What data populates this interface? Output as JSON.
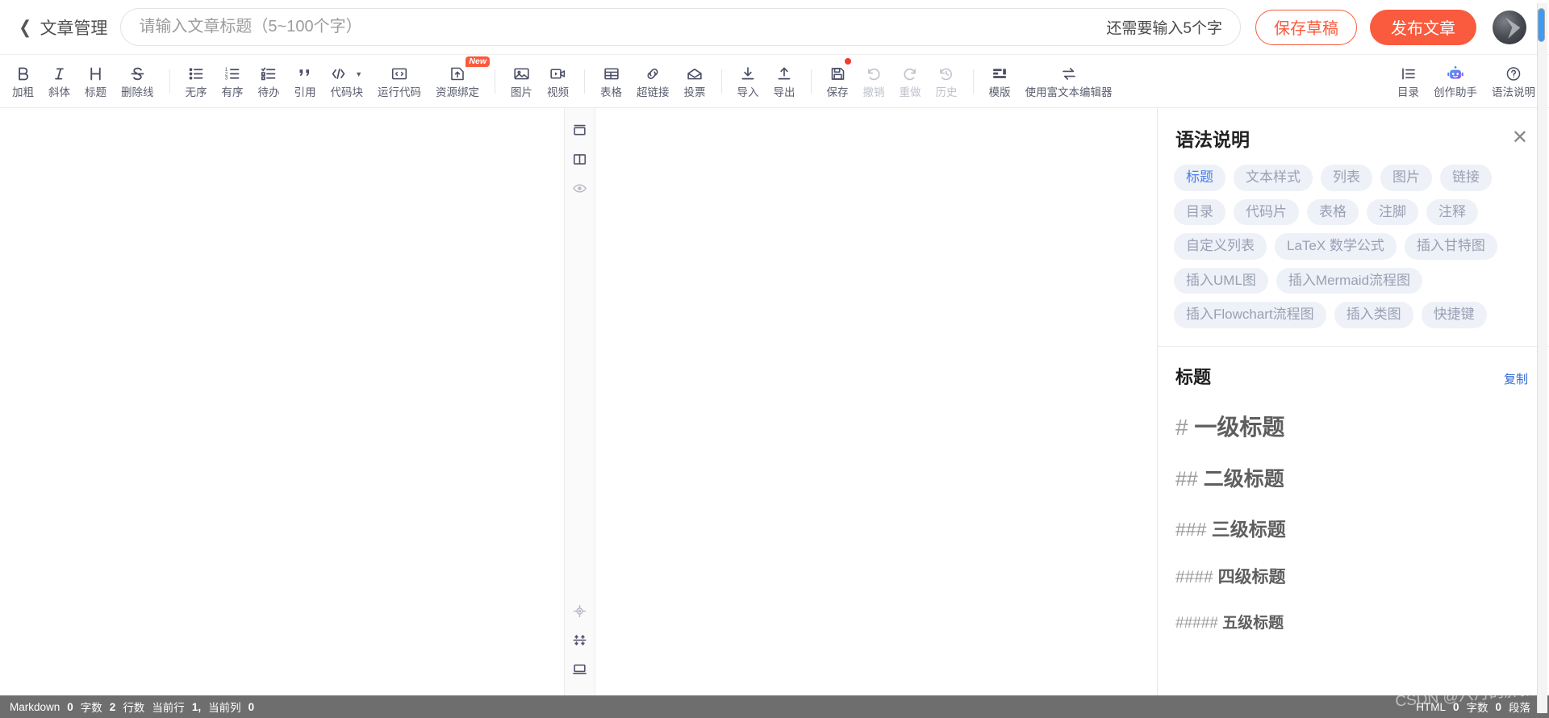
{
  "topbar": {
    "back_label": "文章管理",
    "back_icon": "chevron-left-icon",
    "title_placeholder": "请输入文章标题（5~100个字）",
    "title_value": "",
    "counter_text": "还需要输入5个字",
    "save_draft_label": "保存草稿",
    "publish_label": "发布文章",
    "accent_color": "#fa5a3d",
    "avatar_name": "user-avatar"
  },
  "toolbar": {
    "groups": [
      {
        "items": [
          {
            "icon": "bold-icon",
            "label": "加粗",
            "dim": false
          },
          {
            "icon": "italic-icon",
            "label": "斜体",
            "dim": false
          },
          {
            "icon": "heading-icon",
            "label": "标题",
            "dim": false
          },
          {
            "icon": "strikethrough-icon",
            "label": "删除线",
            "dim": false
          }
        ]
      },
      {
        "items": [
          {
            "icon": "unordered-list-icon",
            "label": "无序",
            "dim": false
          },
          {
            "icon": "ordered-list-icon",
            "label": "有序",
            "dim": false
          },
          {
            "icon": "todo-list-icon",
            "label": "待办",
            "dim": false
          },
          {
            "icon": "quote-icon",
            "label": "引用",
            "dim": false
          },
          {
            "icon": "code-block-icon",
            "label": "代码块",
            "dim": false,
            "caret": true
          },
          {
            "icon": "run-code-icon",
            "label": "运行代码",
            "dim": false
          },
          {
            "icon": "resource-bind-icon",
            "label": "资源绑定",
            "dim": false,
            "badge": "New"
          }
        ]
      },
      {
        "items": [
          {
            "icon": "image-icon",
            "label": "图片",
            "dim": false
          },
          {
            "icon": "video-icon",
            "label": "视频",
            "dim": false
          }
        ]
      },
      {
        "items": [
          {
            "icon": "table-icon",
            "label": "表格",
            "dim": false
          },
          {
            "icon": "link-icon",
            "label": "超链接",
            "dim": false
          },
          {
            "icon": "vote-icon",
            "label": "投票",
            "dim": false
          }
        ]
      },
      {
        "items": [
          {
            "icon": "import-icon",
            "label": "导入",
            "dim": false
          },
          {
            "icon": "export-icon",
            "label": "导出",
            "dim": false
          }
        ]
      },
      {
        "items": [
          {
            "icon": "save-icon",
            "label": "保存",
            "dim": false,
            "dot": true
          },
          {
            "icon": "undo-icon",
            "label": "撤销",
            "dim": true
          },
          {
            "icon": "redo-icon",
            "label": "重做",
            "dim": true
          },
          {
            "icon": "history-icon",
            "label": "历史",
            "dim": true
          }
        ]
      },
      {
        "items": [
          {
            "icon": "template-icon",
            "label": "模版",
            "dim": false
          },
          {
            "icon": "switch-editor-icon",
            "label": "使用富文本编辑器",
            "dim": false
          }
        ]
      },
      {
        "items": [
          {
            "icon": "outline-icon",
            "label": "目录",
            "dim": false
          },
          {
            "icon": "ai-assistant-icon",
            "label": "创作助手",
            "dim": false
          },
          {
            "icon": "help-icon",
            "label": "语法说明",
            "dim": false
          }
        ]
      }
    ]
  },
  "gutter": {
    "top_items": [
      {
        "icon": "single-column-view-icon"
      },
      {
        "icon": "split-view-icon"
      },
      {
        "icon": "preview-eye-icon"
      }
    ],
    "bottom_items": [
      {
        "icon": "sync-scroll-icon"
      },
      {
        "icon": "fit-width-icon"
      },
      {
        "icon": "fullscreen-icon"
      }
    ]
  },
  "syntax_panel": {
    "title": "语法说明",
    "close_icon": "close-icon",
    "tags": [
      {
        "label": "标题",
        "active": true
      },
      {
        "label": "文本样式",
        "active": false
      },
      {
        "label": "列表",
        "active": false
      },
      {
        "label": "图片",
        "active": false
      },
      {
        "label": "链接",
        "active": false
      },
      {
        "label": "目录",
        "active": false
      },
      {
        "label": "代码片",
        "active": false
      },
      {
        "label": "表格",
        "active": false
      },
      {
        "label": "注脚",
        "active": false
      },
      {
        "label": "注释",
        "active": false
      },
      {
        "label": "自定义列表",
        "active": false
      },
      {
        "label": "LaTeX 数学公式",
        "active": false
      },
      {
        "label": "插入甘特图",
        "active": false
      },
      {
        "label": "插入UML图",
        "active": false
      },
      {
        "label": "插入Mermaid流程图",
        "active": false
      },
      {
        "label": "插入Flowchart流程图",
        "active": false
      },
      {
        "label": "插入类图",
        "active": false
      },
      {
        "label": "快捷键",
        "active": false
      }
    ],
    "section_title": "标题",
    "copy_label": "复制",
    "examples": [
      {
        "hash": "#",
        "text": "一级标题",
        "size": "h1"
      },
      {
        "hash": "##",
        "text": "二级标题",
        "size": "h2"
      },
      {
        "hash": "###",
        "text": "三级标题",
        "size": "h3"
      },
      {
        "hash": "####",
        "text": "四级标题",
        "size": "h4"
      },
      {
        "hash": "#####",
        "text": "五级标题",
        "size": "h5"
      }
    ]
  },
  "statusbar": {
    "mode": "Markdown",
    "word_count_value": "0",
    "word_count_label": "字数",
    "line_count_value": "2",
    "line_count_label": "行数",
    "cursor_line_label": "当前行",
    "cursor_line_value": "1,",
    "cursor_col_label": "当前列",
    "cursor_col_value": "0",
    "right_mode": "HTML",
    "right_word_value": "0",
    "right_word_label": "字数",
    "right_para_value": "0",
    "right_para_label": "段落"
  },
  "watermark": "CSDN @六月的胖猪"
}
